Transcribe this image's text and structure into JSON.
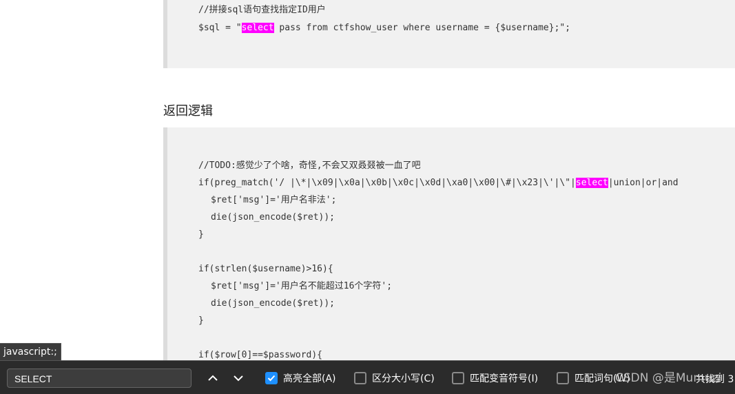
{
  "block1": {
    "comment": "//拼接sql语句查找指定ID用户",
    "sql_prefix": "$sql = \"",
    "sql_highlight": "select",
    "sql_suffix": " pass from ctfshow_user where username = {$username};\";"
  },
  "heading": "返回逻辑",
  "block2": {
    "comment": "//TODO:感觉少了个啥，奇怪,不会又双叒叕被一血了吧",
    "if_prefix": "if(preg_match('/ |\\*|\\x09|\\x0a|\\x0b|\\x0c|\\x0d|\\xa0|\\x00|\\#|\\x23|\\'|\\\"|",
    "if_highlight": "select",
    "if_suffix": "|union|or|and",
    "l3": "$ret['msg']='用户名非法';",
    "l4": "die(json_encode($ret));",
    "l5": "}",
    "l6": "if(strlen($username)>16){",
    "l7": "$ret['msg']='用户名不能超过16个字符';",
    "l8": "die(json_encode($ret));",
    "l9": "}",
    "l10": "if($row[0]==$password){"
  },
  "status_tooltip": "javascript:;",
  "findbar": {
    "query": "SELECT",
    "highlight_all": {
      "label": "高亮全部(A)",
      "checked": true
    },
    "match_case": {
      "label": "区分大小写(C)",
      "checked": false
    },
    "match_diacritics": {
      "label": "匹配变音符号(I)",
      "checked": false
    },
    "whole_words": {
      "label": "匹配词句(W)",
      "checked": false
    },
    "match_count": "共找到 3",
    "watermark": "CSDN @是Mumuzi"
  },
  "colors": {
    "highlight": "#ff00ff",
    "checkbox_checked": "#1e90ff",
    "findbar_bg": "#2b2b2b"
  }
}
